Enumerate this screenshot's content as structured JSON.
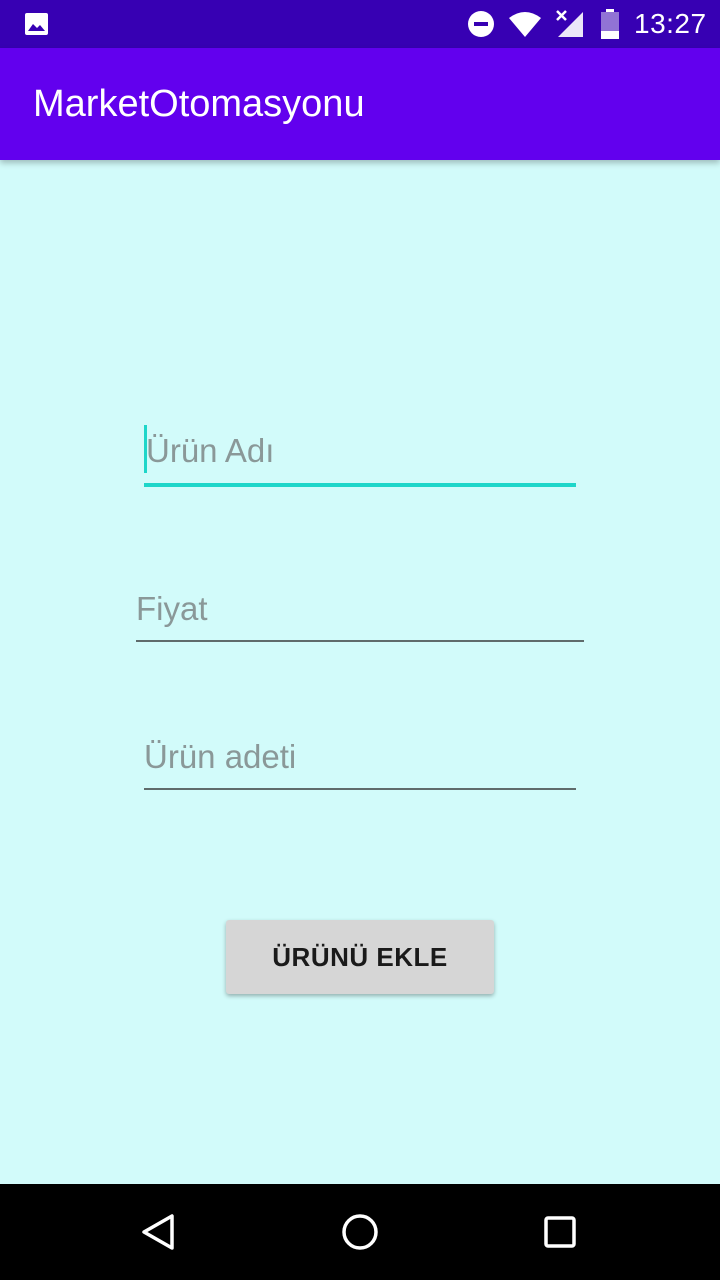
{
  "status_bar": {
    "time": "13:27",
    "icons": [
      "gallery-icon",
      "do-not-disturb-icon",
      "wifi-icon",
      "signal-icon",
      "battery-icon"
    ]
  },
  "app_bar": {
    "title": "MarketOtomasyonu",
    "color": "#6200EE"
  },
  "form": {
    "product_name": {
      "value": "",
      "placeholder": "Ürün Adı"
    },
    "price": {
      "value": "",
      "placeholder": "Fiyat"
    },
    "quantity": {
      "value": "",
      "placeholder": "Ürün adeti"
    },
    "add_button_label": "ÜRÜNÜ EKLE"
  },
  "nav_bar": {
    "icons": [
      "back-icon",
      "home-icon",
      "recents-icon"
    ]
  },
  "colors": {
    "status_bar": "#3700B3",
    "background": "#D2FBFA",
    "accent": "#1ED6C9",
    "button": "#D6D6D6"
  }
}
